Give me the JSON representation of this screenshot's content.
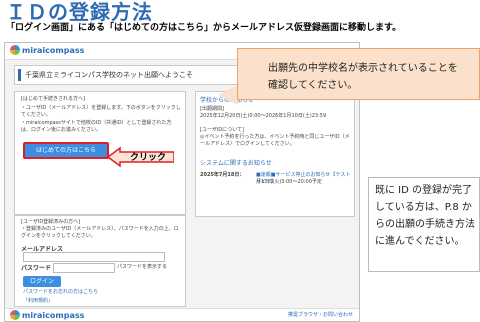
{
  "title": "ＩＤの登録方法",
  "description": "「ログイン画面」にある「はじめての方はこちら」からメールアドレス仮登録画面に移動します。",
  "logo": "miraicompass",
  "school_name": "千葉県立ミライコンパス学校のネット出願へようこそ",
  "first_time_section": {
    "heading": "[はじめて手続きされる方へ]",
    "line1": "・ユーザID（メールアドレス）を登録します。下のボタンをクリックしてください。",
    "line2": "・miraicompassサイトで他校のID（共通ID）として登録された方は、ログイン後にお進みください。",
    "button": "はじめての方はこちら"
  },
  "login_section": {
    "heading": "[ユーザID登録済みの方へ]",
    "line1": "・登録済みのユーザID（メールアドレス）、パスワードを入力の上、ログインをクリックしてください。",
    "email_label": "メールアドレス",
    "password_label": "パスワード",
    "show_password": "パスワードを表示する",
    "login_button": "ログイン",
    "forgot_link": "パスワードをお忘れの方はこちら",
    "terms_link": "『利用規約』"
  },
  "right_panel": {
    "school_notice_heading": "学校からのお知らせ",
    "notice_title": "[出願期間]",
    "notice_date": "2025年12月20日(土)0:00～2026年1月10日(土)23:59",
    "userid_title": "[ユーザIDについて]",
    "userid_text": "◎イベント予約を行った方は、イベント予約時と同じユーザID（メールアドレス）でログインしてください。",
    "system_heading": "システムに関するお知らせ",
    "system_date": "2025年7月18日：",
    "system_text": "■速報■サービス停止のお知らせ【テストサイト】",
    "system_time": "月13日(火)3:00～20:00予定"
  },
  "footer_logo": "miraicompass",
  "footer_link": "推奨ブラウザ・お問い合わせ",
  "callout": {
    "line1": "出願先の中学校名が表示されていることを",
    "line2": "確認してください。"
  },
  "click_label": "クリック",
  "note": {
    "text": "既に ID の登録が完了している方は、P.8 からの出願の手続き方法に進んでください。"
  },
  "colors": {
    "title_blue": "#2d6cb5",
    "button_blue": "#3d8ee0",
    "callout_fill": "#fbe1cc",
    "highlight_red": "#e02020"
  }
}
